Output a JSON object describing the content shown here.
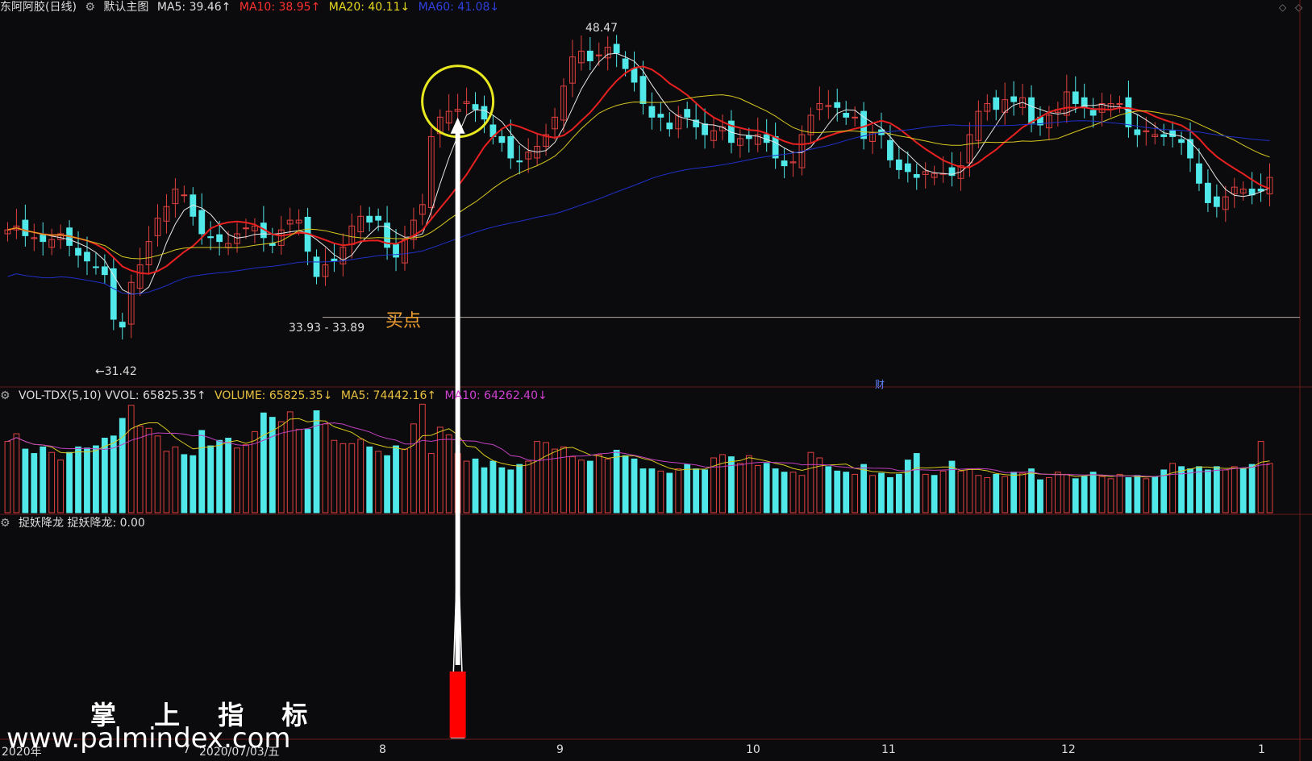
{
  "main_panel": {
    "stock_name": "东阿阿胶(日线)",
    "template": "默认主图",
    "ma5": "MA5: 39.46↑",
    "ma10": "MA10: 38.95↑",
    "ma20": "MA20: 40.11↓",
    "ma60": "MA60: 41.08↓",
    "high_label": "48.47",
    "low_label": "←31.42",
    "mid_label": "33.93 - 33.89",
    "buy_point_label": "买点",
    "cai_marker": "财"
  },
  "volume_panel": {
    "title": "VOL-TDX(5,10) VVOL: 65825.35↑",
    "volume": "VOLUME: 65825.35↓",
    "ma5": "MA5: 74442.16↑",
    "ma10": "MA10: 64262.40↓"
  },
  "indicator_panel": {
    "title": "捉妖降龙 捉妖降龙: 0.00"
  },
  "x_axis": {
    "labels": [
      "2020年",
      "7",
      "2020/07/03/五",
      "8",
      "9",
      "10",
      "11",
      "12",
      "1"
    ]
  },
  "watermark": {
    "line1": "掌 上 指 标",
    "line2": "www.palmindex.com"
  },
  "colors": {
    "up": "#e04040",
    "down": "#50e8e8",
    "ma5": "#e8e8e8",
    "ma10": "#e82020",
    "ma20": "#d8c820",
    "ma60": "#2030c8",
    "vol_ma10": "#c040c0",
    "buy_circle": "#e8e820",
    "signal": "#ff0000"
  },
  "chart_data": {
    "type": "candlestick",
    "price_range": [
      30.8,
      49.8
    ],
    "volume_range": [
      0,
      100000
    ],
    "indicator_range": [
      0,
      1
    ],
    "closes": [
      38.8,
      39.0,
      38.5,
      38.4,
      38.2,
      38.3,
      38.6,
      38.0,
      37.5,
      37.2,
      36.9,
      36.5,
      34.2,
      33.8,
      36.1,
      37.0,
      38.2,
      39.4,
      40.0,
      40.9,
      40.6,
      39.5,
      38.6,
      38.4,
      38.2,
      38.1,
      38.6,
      38.9,
      39.0,
      38.4,
      38.0,
      38.8,
      39.3,
      39.3,
      37.7,
      36.4,
      37.0,
      37.2,
      37.9,
      39.0,
      39.5,
      39.2,
      39.3,
      37.9,
      37.4,
      38.3,
      39.3,
      40.1,
      43.6,
      44.6,
      44.9,
      45.0,
      45.4,
      45.0,
      44.5,
      43.6,
      43.3,
      42.5,
      42.3,
      42.8,
      43.1,
      43.7,
      44.6,
      46.2,
      47.7,
      48.0,
      47.5,
      47.8,
      48.2,
      47.9,
      47.1,
      46.4,
      45.3,
      44.6,
      44.6,
      44.0,
      44.7,
      44.6,
      44.1,
      43.7,
      43.9,
      44.1,
      43.3,
      43.5,
      43.5,
      43.7,
      43.3,
      42.5,
      42.1,
      42.3,
      43.7,
      44.7,
      45.3,
      45.2,
      45.1,
      44.6,
      44.6,
      43.5,
      43.8,
      43.7,
      42.4,
      41.9,
      41.8,
      41.5,
      41.8,
      41.7,
      41.7,
      41.6,
      42.1,
      43.7,
      44.9,
      45.3,
      45.0,
      45.5,
      45.4,
      45.6,
      44.3,
      44.2,
      44.7,
      45.0,
      45.9,
      45.3,
      45.1,
      44.7,
      45.3,
      45.3,
      45.3,
      44.1,
      43.7,
      43.9,
      43.7,
      43.6,
      43.6,
      43.3,
      42.5,
      41.2,
      40.2,
      40.0,
      40.5,
      41.0,
      40.9,
      40.6,
      40.8,
      41.5
    ],
    "volumes": [
      65000,
      72000,
      58000,
      54000,
      60000,
      55000,
      48000,
      55000,
      60000,
      59000,
      61000,
      68000,
      70000,
      86000,
      98000,
      79000,
      77000,
      70000,
      56000,
      60000,
      53000,
      52000,
      75000,
      61000,
      66000,
      68000,
      59000,
      62000,
      74000,
      91000,
      87000,
      83000,
      92000,
      76000,
      76000,
      93000,
      81000,
      66000,
      63000,
      63000,
      67000,
      60000,
      56000,
      52000,
      61000,
      58000,
      81000,
      99000,
      54000,
      78000,
      71000,
      54000,
      47000,
      49000,
      41000,
      47000,
      41000,
      39000,
      44000,
      47000,
      65000,
      64000,
      58000,
      60000,
      51000,
      48000,
      47000,
      53000,
      49000,
      57000,
      52000,
      49000,
      40000,
      40000,
      38000,
      36000,
      40000,
      44000,
      40000,
      39000,
      50000,
      53000,
      51000,
      45000,
      52000,
      43000,
      45000,
      40000,
      37000,
      37000,
      34000,
      55000,
      50000,
      42000,
      38000,
      37000,
      35000,
      44000,
      34000,
      36000,
      32000,
      35000,
      48000,
      54000,
      35000,
      34000,
      38000,
      47000,
      38000,
      40000,
      34000,
      32000,
      35000,
      33000,
      37000,
      36000,
      40000,
      30000,
      32000,
      37000,
      35000,
      31000,
      33000,
      37000,
      33000,
      31000,
      35000,
      32000,
      34000,
      31000,
      33000,
      39000,
      45000,
      42000,
      40000,
      42000,
      39000,
      42000,
      39000,
      42000,
      40000,
      44000,
      65000,
      45000
    ],
    "signal": {
      "index": 52,
      "value": 1
    },
    "support_line": 34.3
  }
}
